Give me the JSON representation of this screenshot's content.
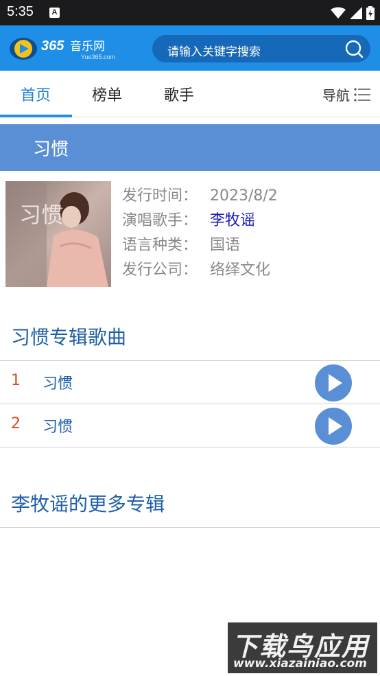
{
  "status_bar": {
    "time": "5:35",
    "notification_letter": "A",
    "icons": [
      "wifi-icon",
      "signal-icon",
      "battery-icon"
    ]
  },
  "header": {
    "logo_text": "365音乐网",
    "logo_sub": "Yue365.com",
    "search_placeholder": "请输入关键字搜索",
    "brand_color": "#1e8ee6"
  },
  "tabs": [
    {
      "label": "首页",
      "active": true
    },
    {
      "label": "榜单",
      "active": false
    },
    {
      "label": "歌手",
      "active": false
    }
  ],
  "nav_label": "导航",
  "album": {
    "title": "习惯",
    "cover_text": "习惯",
    "info": [
      {
        "label": "发行时间：",
        "value": "2023/8/2"
      },
      {
        "label": "演唱歌手：",
        "value": "李牧谣"
      },
      {
        "label": "语言种类：",
        "value": "国语"
      },
      {
        "label": "发行公司：",
        "value": "络绎文化"
      }
    ]
  },
  "songs_section_title": "习惯专辑歌曲",
  "songs": [
    {
      "number": "1",
      "name": "习惯"
    },
    {
      "number": "2",
      "name": "习惯"
    }
  ],
  "more_albums_title": "李牧谣的更多专辑",
  "watermark": {
    "title": "下载鸟应用",
    "url": "www.xiazainiao.com"
  }
}
